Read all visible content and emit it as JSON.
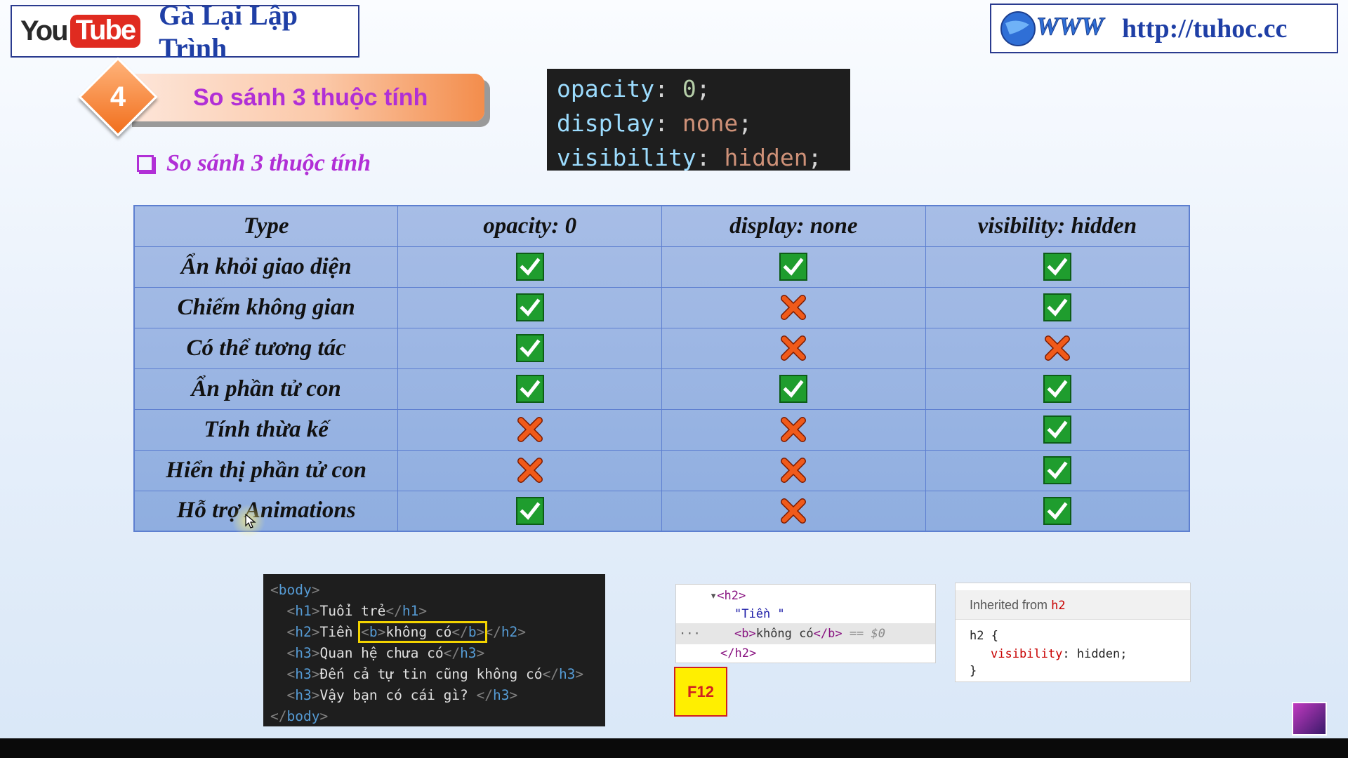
{
  "header": {
    "youtube_you": "You",
    "youtube_tube": "Tube",
    "channel_name": "Gà Lại Lập Trình",
    "url": "http://tuhoc.cc",
    "globe_text": "WWW"
  },
  "section": {
    "number": "4",
    "title": "So sánh 3 thuộc tính",
    "subheading": "So sánh 3 thuộc tính"
  },
  "css_snippet": {
    "lines": [
      {
        "prop": "opacity",
        "value": "0"
      },
      {
        "prop": "display",
        "value": "none"
      },
      {
        "prop": "visibility",
        "value": "hidden"
      }
    ]
  },
  "table": {
    "headers": [
      "Type",
      "opacity: 0",
      "display: none",
      "visibility: hidden"
    ],
    "rows": [
      {
        "feature": "Ẩn khỏi giao diện",
        "values": [
          true,
          true,
          true
        ]
      },
      {
        "feature": "Chiếm không gian",
        "values": [
          true,
          false,
          true
        ]
      },
      {
        "feature": "Có thể tương tác",
        "values": [
          true,
          false,
          false
        ]
      },
      {
        "feature": "Ẩn phần tử con",
        "values": [
          true,
          true,
          true
        ]
      },
      {
        "feature": "Tính thừa kế",
        "values": [
          false,
          false,
          true
        ]
      },
      {
        "feature": "Hiển thị phần tử con",
        "values": [
          false,
          false,
          true
        ]
      },
      {
        "feature": "Hỗ trợ Animations",
        "values": [
          true,
          false,
          true
        ]
      }
    ]
  },
  "html_snippet": {
    "body_open": "body",
    "h1_tag": "h1",
    "h1_text": "Tuổi trẻ",
    "h2_tag": "h2",
    "h2_text": "Tiền ",
    "b_tag": "b",
    "b_text": "không có",
    "h3_tag": "h3",
    "h3_1_text": "Quan hệ chưa có",
    "h3_2_text": "Đến cả tự tin cũng không có",
    "h3_3_text": "Vậy bạn có cái gì? "
  },
  "devtools": {
    "elements": {
      "h2_open": "<h2>",
      "text_node": "\"Tiền \"",
      "b_open": "<b>",
      "b_text": "không có",
      "b_close": "</b>",
      "selected_marker": "== $0",
      "h2_close": "</h2>",
      "ellipsis": "···"
    },
    "f12_label": "F12",
    "styles": {
      "inherited_label": "Inherited from",
      "inherited_selector": "h2",
      "rule_selector": "h2 {",
      "property": "visibility",
      "value": "hidden;",
      "rule_close": "}"
    }
  },
  "colors": {
    "accent_purple": "#b12fd6",
    "brand_blue": "#1f3fa6",
    "check_green": "#1f9d2e",
    "cross_orange": "#f05a1a",
    "highlight_yellow": "#f2d300"
  },
  "icons": {
    "yes": "check-icon",
    "no": "cross-icon"
  }
}
